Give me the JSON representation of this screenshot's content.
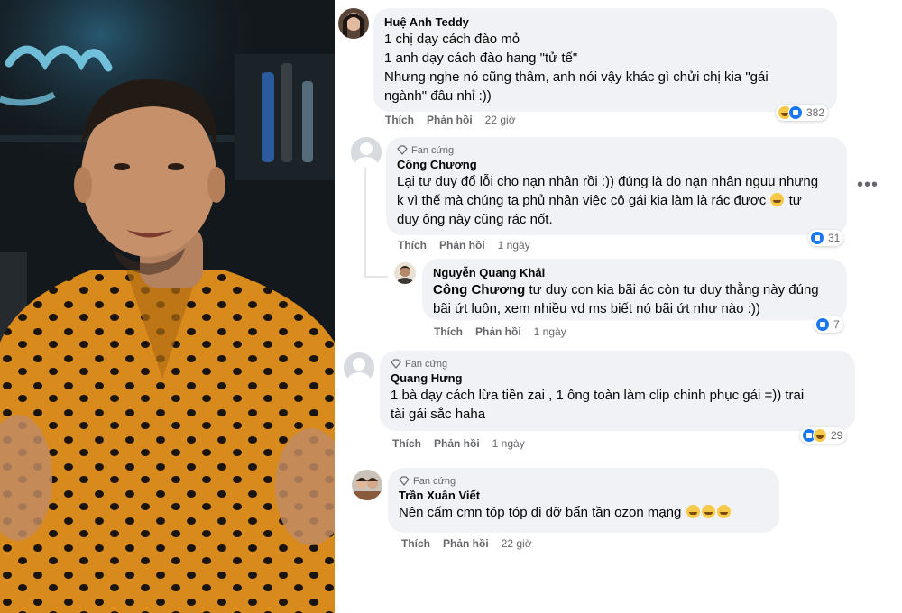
{
  "comments": [
    {
      "author": "Huệ Anh Teddy",
      "lines": [
        "1 chị dạy cách đào mỏ",
        "1 anh dạy cách đào hang \"tử tế\"",
        "Nhưng nghe nó cũng thâm, anh nói vậy khác gì chửi chị kia \"gái",
        "ngành\" đâu nhỉ :))"
      ],
      "like": "Thích",
      "reply": "Phản hồi",
      "time": "22 giờ",
      "reactions": [
        "haha",
        "like"
      ],
      "reaction_count": "382"
    },
    {
      "badge": "Fan cứng",
      "author": "Công Chương",
      "lines": [
        "Lại tư duy đổ lỗi cho nạn nhân rồi :)) đúng là do nạn nhân nguu nhưng",
        "k vì thế mà chúng ta phủ nhận việc cô gái kia làm là rác được",
        "tư",
        "duy ông này cũng rác nốt."
      ],
      "like": "Thích",
      "reply": "Phản hồi",
      "time": "1 ngày",
      "reactions": [
        "like"
      ],
      "reaction_count": "31"
    },
    {
      "author": "Nguyễn Quang Khải",
      "mention": "Công Chương",
      "lines": [
        "tư duy con kia bãi ác còn tư duy thằng này đúng",
        "bãi ứt luôn, xem nhiều vd ms biết nó bãi ứt như nào :))"
      ],
      "like": "Thích",
      "reply": "Phản hồi",
      "time": "1 ngày",
      "reactions": [
        "like"
      ],
      "reaction_count": "7"
    },
    {
      "badge": "Fan cứng",
      "author": "Quang Hưng",
      "lines": [
        "1 bà dạy cách lừa tiền zai , 1 ông toàn làm clip chinh phục gái =)) trai",
        "tài gái sắc haha"
      ],
      "like": "Thích",
      "reply": "Phản hồi",
      "time": "1 ngày",
      "reactions": [
        "like",
        "haha"
      ],
      "reaction_count": "29"
    },
    {
      "badge": "Fan cứng",
      "author": "Trần Xuân Viết",
      "lines": [
        "Nên cấm cmn tóp tóp đi đỡ bẩn tần ozon mạng"
      ],
      "like": "Thích",
      "reply": "Phản hồi",
      "time": "22 giờ"
    }
  ],
  "menu": {
    "more": "•••"
  },
  "icons": {
    "badge": "diamond-icon",
    "more": "more-options-icon",
    "like": "like-reaction-icon",
    "haha": "haha-reaction-icon"
  },
  "colors": {
    "bubble": "#f0f2f5",
    "meta": "#65676b",
    "like": "#1877f2",
    "photo_bg": "#13181c",
    "shirt": "#d98a1c"
  }
}
